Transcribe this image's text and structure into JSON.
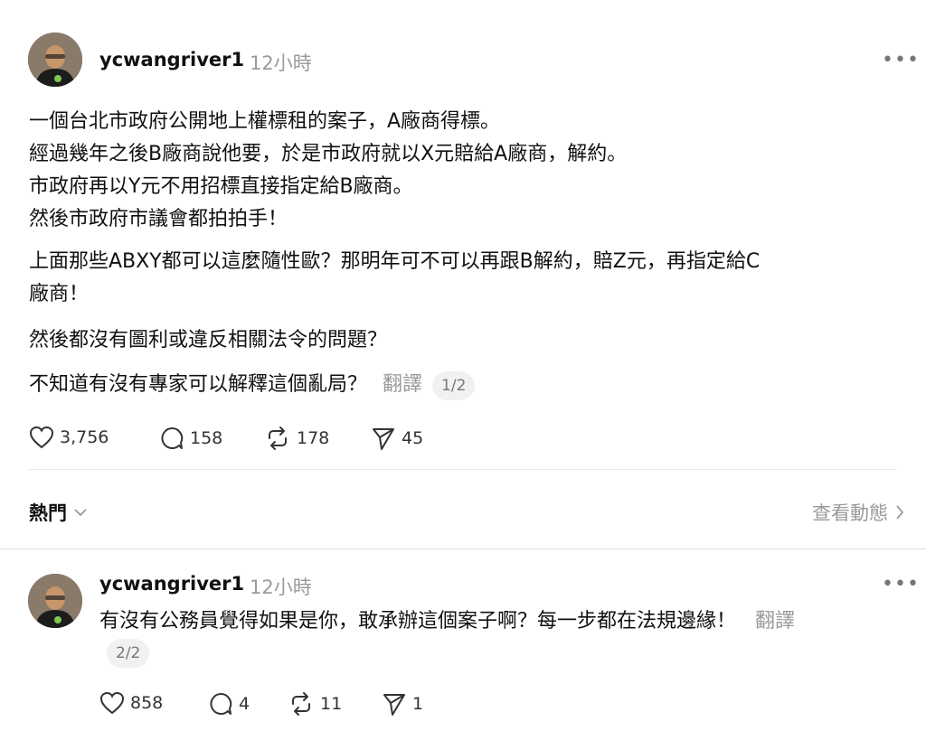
{
  "post": {
    "username": "ycwangriver1",
    "time": "12小時",
    "more": "•••",
    "lines": [
      "一個台北市政府公開地上權標租的案子，A廠商得標。",
      "經過幾年之後B廠商說他要，於是市政府就以X元賠給A廠商，解約。",
      "市政府再以Y元不用招標直接指定給B廠商。",
      "然後市政府市議會都拍拍手！"
    ],
    "para2_line1": "上面那些ABXY都可以這麼隨性歐？那明年可不可以再跟B解約，賠Z元，再指定給C",
    "para2_line2": "廠商！",
    "para3": "然後都沒有圖利或違反相關法令的問題？",
    "para4": "不知道有沒有專家可以解釋這個亂局？",
    "translate": "翻譯",
    "pager": "1/2",
    "likes": "3,756",
    "comments": "158",
    "reposts": "178",
    "shares": "45"
  },
  "sort_bar": {
    "label": "熱門",
    "activity": "查看動態"
  },
  "reply": {
    "username": "ycwangriver1",
    "time": "12小時",
    "more": "•••",
    "text": "有沒有公務員覺得如果是你，敢承辦這個案子啊？每一步都在法規邊緣！",
    "translate": "翻譯",
    "pager": "2/2",
    "likes": "858",
    "comments": "4",
    "reposts": "11",
    "shares": "1"
  }
}
